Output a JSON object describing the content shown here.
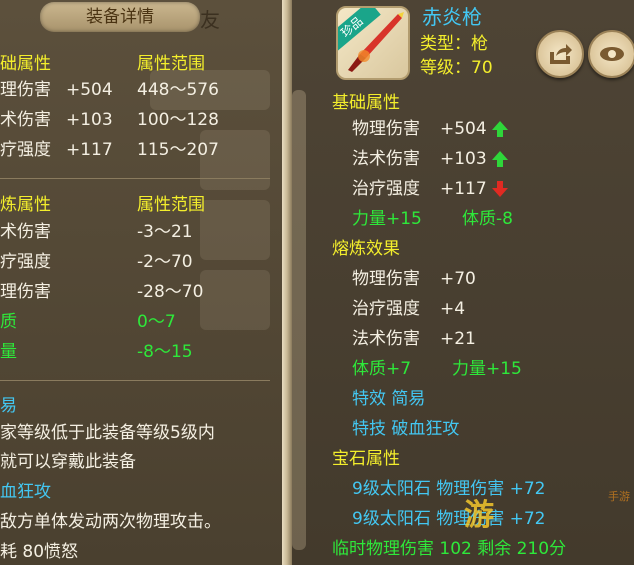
{
  "left": {
    "title": "装备详情",
    "peek_text": "友",
    "base_header": "础属性",
    "range_header": "属性范围",
    "base_stats": [
      {
        "name": "理伤害",
        "value": "+504",
        "range": "448～576"
      },
      {
        "name": "术伤害",
        "value": "+103",
        "range": "100～128"
      },
      {
        "name": "疗强度",
        "value": "+117",
        "range": "115～207"
      }
    ],
    "refine_header": "炼属性",
    "refine_range_header": "属性范围",
    "refine_stats": [
      {
        "name": "术伤害",
        "range": "-3～21"
      },
      {
        "name": "疗强度",
        "range": "-2～70"
      },
      {
        "name": "理伤害",
        "range": "-28～70"
      }
    ],
    "refine_green": [
      {
        "name": "质",
        "range": "0～7"
      },
      {
        "name": "量",
        "range": "-8～15"
      }
    ],
    "trade_header": "易",
    "trade_lines": [
      "家等级低于此装备等级5级内",
      "就可以穿戴此装备"
    ],
    "skill_header": "血狂攻",
    "skill_desc": "敌方单体发动两次物理攻击。",
    "skill_cost": "耗 80愤怒"
  },
  "right": {
    "item_name": "赤炎枪",
    "rarity_badge": "珍品",
    "type_line": "类型：枪",
    "level_line": "等级：70",
    "base_header": "基础属性",
    "base_stats": [
      {
        "name": "物理伤害",
        "value": "+504",
        "trend": "up"
      },
      {
        "name": "法术伤害",
        "value": "+103",
        "trend": "up"
      },
      {
        "name": "治疗强度",
        "value": "+117",
        "trend": "down"
      }
    ],
    "base_green": [
      "力量+15",
      "体质-8"
    ],
    "refine_header": "熔炼效果",
    "refine_stats": [
      {
        "name": "物理伤害",
        "value": "+70"
      },
      {
        "name": "治疗强度",
        "value": "+4"
      },
      {
        "name": "法术伤害",
        "value": "+21"
      }
    ],
    "refine_green": [
      "体质+7",
      "力量+15"
    ],
    "special_effect": "特效  简易",
    "special_skill": "特技  破血狂攻",
    "gem_header": "宝石属性",
    "gems": [
      "9级太阳石  物理伤害  +72",
      "9级太阳石  物理伤害  +72"
    ],
    "temp_line": "临时物理伤害  102  剩余  210分"
  },
  "colors": {
    "yellow": "#f3ee2c",
    "green": "#2ee83a",
    "cyan": "#43c7f2",
    "white": "#f4efe2",
    "up_arrow": "#2fd63a",
    "down_arrow": "#e02a22"
  },
  "icons": [
    "share-icon",
    "eye-icon",
    "up-arrow-icon",
    "down-arrow-icon",
    "spear-icon"
  ],
  "watermark": {
    "text": "游",
    "small": "手游"
  }
}
